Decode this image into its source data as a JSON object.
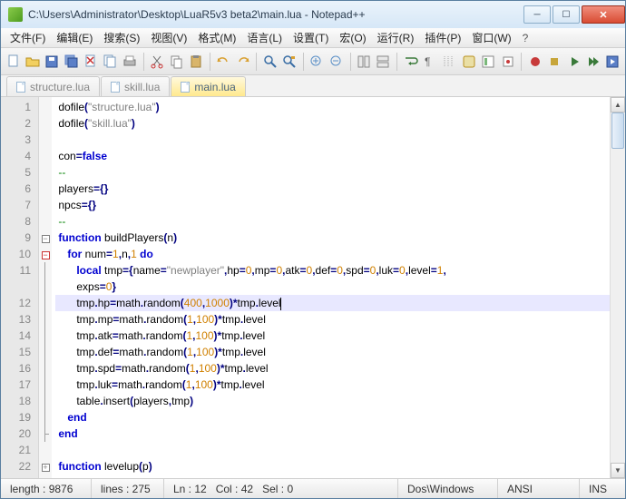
{
  "window": {
    "title": "C:\\Users\\Administrator\\Desktop\\LuaR5v3 beta2\\main.lua - Notepad++"
  },
  "menu": {
    "items": [
      "文件(F)",
      "编辑(E)",
      "搜索(S)",
      "视图(V)",
      "格式(M)",
      "语言(L)",
      "设置(T)",
      "宏(O)",
      "运行(R)",
      "插件(P)",
      "窗口(W)"
    ],
    "help": "?"
  },
  "tabs": [
    {
      "label": "structure.lua",
      "active": false
    },
    {
      "label": "skill.lua",
      "active": false
    },
    {
      "label": "main.lua",
      "active": true
    }
  ],
  "code": {
    "lines": [
      {
        "n": 1,
        "f": "",
        "seg": [
          [
            "fn",
            "dofile"
          ],
          [
            "op",
            "("
          ],
          [
            "str",
            "\"structure.lua\""
          ],
          [
            "op",
            ")"
          ]
        ]
      },
      {
        "n": 2,
        "f": "",
        "seg": [
          [
            "fn",
            "dofile"
          ],
          [
            "op",
            "("
          ],
          [
            "str",
            "\"skill.lua\""
          ],
          [
            "op",
            ")"
          ]
        ]
      },
      {
        "n": 3,
        "f": "",
        "seg": []
      },
      {
        "n": 4,
        "f": "",
        "seg": [
          [
            "id",
            "con"
          ],
          [
            "op",
            "="
          ],
          [
            "kw",
            "false"
          ]
        ]
      },
      {
        "n": 5,
        "f": "",
        "seg": [
          [
            "cm",
            "--"
          ]
        ]
      },
      {
        "n": 6,
        "f": "",
        "seg": [
          [
            "id",
            "players"
          ],
          [
            "op",
            "={}"
          ]
        ]
      },
      {
        "n": 7,
        "f": "",
        "seg": [
          [
            "id",
            "npcs"
          ],
          [
            "op",
            "={}"
          ]
        ]
      },
      {
        "n": 8,
        "f": "",
        "seg": [
          [
            "cm",
            "--"
          ]
        ]
      },
      {
        "n": 9,
        "f": "minus",
        "seg": [
          [
            "kw",
            "function"
          ],
          [
            "id",
            " buildPlayers"
          ],
          [
            "op",
            "("
          ],
          [
            "id",
            "n"
          ],
          [
            "op",
            ")"
          ]
        ]
      },
      {
        "n": 10,
        "f": "minus-r",
        "ind": 1,
        "seg": [
          [
            "kw",
            "for"
          ],
          [
            "id",
            " num"
          ],
          [
            "op",
            "="
          ],
          [
            "num",
            "1"
          ],
          [
            "op",
            ","
          ],
          [
            "id",
            "n"
          ],
          [
            "op",
            ","
          ],
          [
            "num",
            "1"
          ],
          [
            "kw",
            " do"
          ]
        ]
      },
      {
        "n": 11,
        "f": "line",
        "ind": 2,
        "seg": [
          [
            "kw",
            "local"
          ],
          [
            "id",
            " tmp"
          ],
          [
            "op",
            "={"
          ],
          [
            "id",
            "name"
          ],
          [
            "op",
            "="
          ],
          [
            "str",
            "\"newplayer\""
          ],
          [
            "op",
            ","
          ],
          [
            "id",
            "hp"
          ],
          [
            "op",
            "="
          ],
          [
            "num",
            "0"
          ],
          [
            "op",
            ","
          ],
          [
            "id",
            "mp"
          ],
          [
            "op",
            "="
          ],
          [
            "num",
            "0"
          ],
          [
            "op",
            ","
          ],
          [
            "id",
            "atk"
          ],
          [
            "op",
            "="
          ],
          [
            "num",
            "0"
          ],
          [
            "op",
            ","
          ],
          [
            "id",
            "def"
          ],
          [
            "op",
            "="
          ],
          [
            "num",
            "0"
          ],
          [
            "op",
            ","
          ],
          [
            "id",
            "spd"
          ],
          [
            "op",
            "="
          ],
          [
            "num",
            "0"
          ],
          [
            "op",
            ","
          ],
          [
            "id",
            "luk"
          ],
          [
            "op",
            "="
          ],
          [
            "num",
            "0"
          ],
          [
            "op",
            ","
          ],
          [
            "id",
            "level"
          ],
          [
            "op",
            "="
          ],
          [
            "num",
            "1"
          ],
          [
            "op",
            ","
          ]
        ]
      },
      {
        "n": "",
        "f": "line",
        "ind": 2,
        "seg": [
          [
            "id",
            "exps"
          ],
          [
            "op",
            "="
          ],
          [
            "num",
            "0"
          ],
          [
            "op",
            "}"
          ]
        ]
      },
      {
        "n": 12,
        "f": "line",
        "ind": 2,
        "hl": true,
        "seg": [
          [
            "id",
            "tmp"
          ],
          [
            "op",
            "."
          ],
          [
            "id",
            "hp"
          ],
          [
            "op",
            "="
          ],
          [
            "fn",
            "math"
          ],
          [
            "op",
            "."
          ],
          [
            "fn",
            "random"
          ],
          [
            "op",
            "("
          ],
          [
            "num",
            "400"
          ],
          [
            "op",
            ","
          ],
          [
            "num",
            "1000"
          ],
          [
            "op",
            ")*"
          ],
          [
            "id",
            "tmp"
          ],
          [
            "op",
            "."
          ],
          [
            "id",
            "level"
          ]
        ],
        "caret": true
      },
      {
        "n": 13,
        "f": "line",
        "ind": 2,
        "seg": [
          [
            "id",
            "tmp"
          ],
          [
            "op",
            "."
          ],
          [
            "id",
            "mp"
          ],
          [
            "op",
            "="
          ],
          [
            "fn",
            "math"
          ],
          [
            "op",
            "."
          ],
          [
            "fn",
            "random"
          ],
          [
            "op",
            "("
          ],
          [
            "num",
            "1"
          ],
          [
            "op",
            ","
          ],
          [
            "num",
            "100"
          ],
          [
            "op",
            ")*"
          ],
          [
            "id",
            "tmp"
          ],
          [
            "op",
            "."
          ],
          [
            "id",
            "level"
          ]
        ]
      },
      {
        "n": 14,
        "f": "line",
        "ind": 2,
        "seg": [
          [
            "id",
            "tmp"
          ],
          [
            "op",
            "."
          ],
          [
            "id",
            "atk"
          ],
          [
            "op",
            "="
          ],
          [
            "fn",
            "math"
          ],
          [
            "op",
            "."
          ],
          [
            "fn",
            "random"
          ],
          [
            "op",
            "("
          ],
          [
            "num",
            "1"
          ],
          [
            "op",
            ","
          ],
          [
            "num",
            "100"
          ],
          [
            "op",
            ")*"
          ],
          [
            "id",
            "tmp"
          ],
          [
            "op",
            "."
          ],
          [
            "id",
            "level"
          ]
        ]
      },
      {
        "n": 15,
        "f": "line",
        "ind": 2,
        "seg": [
          [
            "id",
            "tmp"
          ],
          [
            "op",
            "."
          ],
          [
            "id",
            "def"
          ],
          [
            "op",
            "="
          ],
          [
            "fn",
            "math"
          ],
          [
            "op",
            "."
          ],
          [
            "fn",
            "random"
          ],
          [
            "op",
            "("
          ],
          [
            "num",
            "1"
          ],
          [
            "op",
            ","
          ],
          [
            "num",
            "100"
          ],
          [
            "op",
            ")*"
          ],
          [
            "id",
            "tmp"
          ],
          [
            "op",
            "."
          ],
          [
            "id",
            "level"
          ]
        ]
      },
      {
        "n": 16,
        "f": "line",
        "ind": 2,
        "seg": [
          [
            "id",
            "tmp"
          ],
          [
            "op",
            "."
          ],
          [
            "id",
            "spd"
          ],
          [
            "op",
            "="
          ],
          [
            "fn",
            "math"
          ],
          [
            "op",
            "."
          ],
          [
            "fn",
            "random"
          ],
          [
            "op",
            "("
          ],
          [
            "num",
            "1"
          ],
          [
            "op",
            ","
          ],
          [
            "num",
            "100"
          ],
          [
            "op",
            ")*"
          ],
          [
            "id",
            "tmp"
          ],
          [
            "op",
            "."
          ],
          [
            "id",
            "level"
          ]
        ]
      },
      {
        "n": 17,
        "f": "line",
        "ind": 2,
        "seg": [
          [
            "id",
            "tmp"
          ],
          [
            "op",
            "."
          ],
          [
            "id",
            "luk"
          ],
          [
            "op",
            "="
          ],
          [
            "fn",
            "math"
          ],
          [
            "op",
            "."
          ],
          [
            "fn",
            "random"
          ],
          [
            "op",
            "("
          ],
          [
            "num",
            "1"
          ],
          [
            "op",
            ","
          ],
          [
            "num",
            "100"
          ],
          [
            "op",
            ")*"
          ],
          [
            "id",
            "tmp"
          ],
          [
            "op",
            "."
          ],
          [
            "id",
            "level"
          ]
        ]
      },
      {
        "n": 18,
        "f": "line",
        "ind": 2,
        "seg": [
          [
            "fn",
            "table"
          ],
          [
            "op",
            "."
          ],
          [
            "fn",
            "insert"
          ],
          [
            "op",
            "("
          ],
          [
            "id",
            "players"
          ],
          [
            "op",
            ","
          ],
          [
            "id",
            "tmp"
          ],
          [
            "op",
            ")"
          ]
        ]
      },
      {
        "n": 19,
        "f": "line",
        "ind": 1,
        "seg": [
          [
            "kw",
            "end"
          ]
        ]
      },
      {
        "n": 20,
        "f": "end",
        "seg": [
          [
            "kw",
            "end"
          ]
        ]
      },
      {
        "n": 21,
        "f": "",
        "seg": []
      },
      {
        "n": 22,
        "f": "plus",
        "seg": [
          [
            "kw",
            "function"
          ],
          [
            "id",
            " levelup"
          ],
          [
            "op",
            "("
          ],
          [
            "id",
            "p"
          ],
          [
            "op",
            ")"
          ]
        ]
      }
    ]
  },
  "status": {
    "length": "length : 9876",
    "lines": "lines : 275",
    "ln": "Ln : 12",
    "col": "Col : 42",
    "sel": "Sel : 0",
    "eol": "Dos\\Windows",
    "enc": "ANSI",
    "mode": "INS"
  }
}
